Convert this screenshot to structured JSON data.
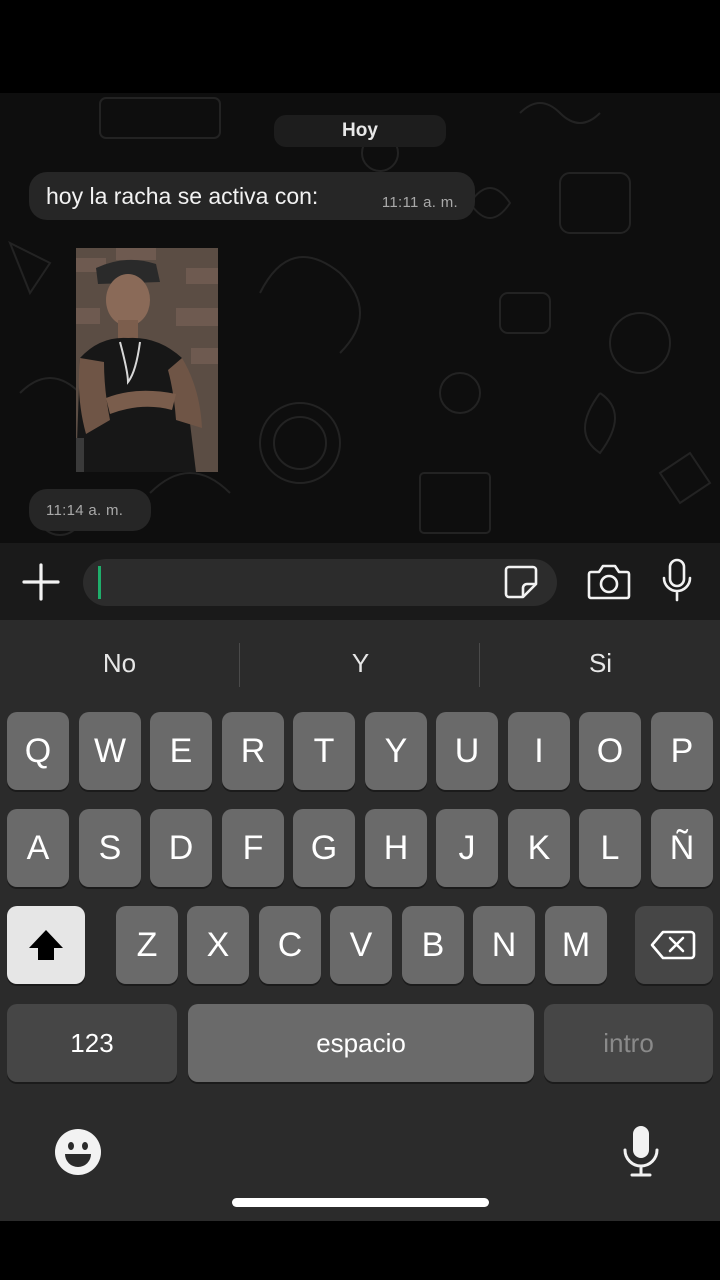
{
  "chat": {
    "date_label": "Hoy",
    "messages": [
      {
        "text": "hoy la racha se activa con:",
        "time": "11:11 a. m."
      },
      {
        "image": "photo-of-man",
        "time": "11:14 a. m."
      }
    ]
  },
  "input_bar": {
    "plus_icon": "plus-icon",
    "sticker_icon": "sticker-icon",
    "camera_icon": "camera-icon",
    "mic_icon": "microphone-icon",
    "caret_color": "#1fae6b"
  },
  "keyboard": {
    "suggestions": [
      "No",
      "Y",
      "Si"
    ],
    "row1": [
      "Q",
      "W",
      "E",
      "R",
      "T",
      "Y",
      "U",
      "I",
      "O",
      "P"
    ],
    "row2": [
      "A",
      "S",
      "D",
      "F",
      "G",
      "H",
      "J",
      "K",
      "L",
      "Ñ"
    ],
    "row3": [
      "Z",
      "X",
      "C",
      "V",
      "B",
      "N",
      "M"
    ],
    "num_label": "123",
    "space_label": "espacio",
    "return_label": "intro",
    "shift_icon": "shift-icon",
    "delete_icon": "backspace-icon",
    "emoji_icon": "emoji-icon",
    "dictation_icon": "microphone-icon"
  }
}
